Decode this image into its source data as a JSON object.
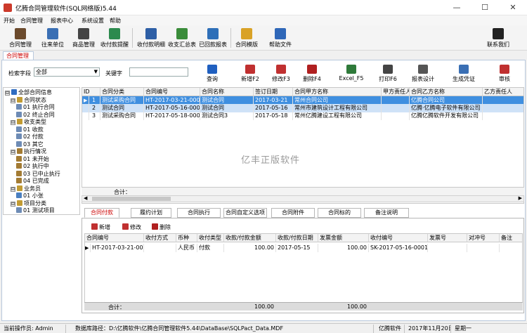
{
  "window": {
    "title": "亿腾合同管理软件(SQL网络版)5.44",
    "minimize": "—",
    "maximize": "☐",
    "close": "✕"
  },
  "menu": [
    "开始",
    "合同管理",
    "报表中心",
    "系统设置",
    "帮助"
  ],
  "toolbar": {
    "items": [
      {
        "label": "合同管理",
        "icon": "contract-icon",
        "color": "#6b4a2c"
      },
      {
        "label": "往来单位",
        "icon": "partner-icon",
        "color": "#3a6fb4"
      },
      {
        "label": "商品管理",
        "icon": "goods-icon",
        "color": "#444444"
      },
      {
        "label": "收付款提醒",
        "icon": "reminder-icon",
        "color": "#2c8a4e"
      },
      {
        "label": "收付款明细",
        "icon": "receipt-detail-icon",
        "color": "#2e5fa6"
      },
      {
        "label": "收支汇总表",
        "icon": "summary-icon",
        "color": "#3a8c3a"
      },
      {
        "label": "已回款报表",
        "icon": "chart-icon",
        "color": "#2e6fb8"
      },
      {
        "label": "合同模版",
        "icon": "template-icon",
        "color": "#d9a227"
      },
      {
        "label": "帮助文件",
        "icon": "help-icon",
        "color": "#2f67b8"
      },
      {
        "label": "联系我们",
        "icon": "qq-icon",
        "color": "#222222"
      }
    ]
  },
  "doc_tab": "合同管理",
  "search": {
    "field_label": "检索字段",
    "field_value": "全部",
    "keyword_label": "关键字",
    "keyword_value": ""
  },
  "search_buttons": [
    {
      "label": "查询",
      "icon": "search-icon",
      "color": "#2060c0"
    },
    {
      "label": "新增F2",
      "icon": "add-icon",
      "color": "#c03030"
    },
    {
      "label": "修改F3",
      "icon": "edit-icon",
      "color": "#c03030"
    },
    {
      "label": "删除F4",
      "icon": "delete-icon",
      "color": "#b02020"
    },
    {
      "label": "Excel_F5",
      "icon": "excel-icon",
      "color": "#2f7a3a"
    },
    {
      "label": "打印F6",
      "icon": "print-icon",
      "color": "#444444"
    },
    {
      "label": "报表设计",
      "icon": "design-icon",
      "color": "#555555"
    },
    {
      "label": "生成凭证",
      "icon": "voucher-icon",
      "color": "#3a6fb4"
    },
    {
      "label": "审核",
      "icon": "audit-icon",
      "color": "#c03030"
    }
  ],
  "tree": [
    {
      "label": "全部合同信息",
      "level": 0,
      "expander": "⊟",
      "icon": "globe-icon",
      "color": "#2f6cc1"
    },
    {
      "label": "合同状态",
      "level": 1,
      "expander": "⊟",
      "icon": "folder-icon",
      "color": "#c29b33"
    },
    {
      "label": "01 执行合同",
      "level": 2,
      "expander": "",
      "icon": "doc-icon",
      "color": "#6d8bb5"
    },
    {
      "label": "02 终止合同",
      "level": 2,
      "expander": "",
      "icon": "doc-icon",
      "color": "#6d8bb5"
    },
    {
      "label": "收支类型",
      "level": 1,
      "expander": "⊟",
      "icon": "folder-icon",
      "color": "#c29b33"
    },
    {
      "label": "01 收款",
      "level": 2,
      "expander": "",
      "icon": "doc-icon",
      "color": "#6d8bb5"
    },
    {
      "label": "02 付款",
      "level": 2,
      "expander": "",
      "icon": "doc-icon",
      "color": "#6d8bb5"
    },
    {
      "label": "03 其它",
      "level": 2,
      "expander": "",
      "icon": "doc-icon",
      "color": "#6d8bb5"
    },
    {
      "label": "执行情况",
      "level": 1,
      "expander": "⊟",
      "icon": "clock-icon",
      "color": "#a37b33"
    },
    {
      "label": "01 未开始",
      "level": 2,
      "expander": "",
      "icon": "clock-icon",
      "color": "#a37b33"
    },
    {
      "label": "02 执行中",
      "level": 2,
      "expander": "",
      "icon": "clock-icon",
      "color": "#a37b33"
    },
    {
      "label": "03 已中止执行",
      "level": 2,
      "expander": "",
      "icon": "clock-icon",
      "color": "#a37b33"
    },
    {
      "label": "04 已完成",
      "level": 2,
      "expander": "",
      "icon": "clock-icon",
      "color": "#a37b33"
    },
    {
      "label": "业务员",
      "level": 1,
      "expander": "⊟",
      "icon": "folder-icon",
      "color": "#c29b33"
    },
    {
      "label": "01 小张",
      "level": 2,
      "expander": "",
      "icon": "person-icon",
      "color": "#4a7fc0"
    },
    {
      "label": "项目分类",
      "level": 1,
      "expander": "⊟",
      "icon": "folder-icon",
      "color": "#c29b33"
    },
    {
      "label": "01 测试项目",
      "level": 2,
      "expander": "",
      "icon": "doc-icon",
      "color": "#6d8bb5"
    }
  ],
  "upper_grid": {
    "columns": [
      "ID",
      "合同分类",
      "合同编号",
      "合同名称",
      "签订日期",
      "合同甲方名称",
      "甲方责任人",
      "合同乙方名称",
      "乙方责任人"
    ],
    "rows": [
      {
        "marker": "▶",
        "cells": [
          "1",
          "测试采购合同",
          "HT-2017-03-21-0001",
          "测试合同",
          "2017-03-21",
          "常州合同公司",
          "",
          "亿腾合同公司",
          ""
        ]
      },
      {
        "marker": "",
        "cells": [
          "2",
          "测试合同",
          "HT-2017-05-16-0001",
          "测试合同",
          "2017-05-16",
          "常州市建筑设计工程有限公司",
          "",
          "亿腾·亿腾电子软件有限公司",
          ""
        ]
      },
      {
        "marker": "",
        "cells": [
          "3",
          "测试采购合同",
          "HT-2017-05-18-0001",
          "测试合同3",
          "2017-05-18",
          "常州亿腾建设工程有限公司",
          "",
          "亿腾亿腾软件开发有限公司",
          ""
        ]
      }
    ],
    "footer_label": "合计：",
    "watermark": "亿丰正版软件"
  },
  "lower_tabs": [
    "合同付款",
    "履约计划",
    "合同执行",
    "合同自定义选项",
    "合同附件",
    "合同标的",
    "备注说明"
  ],
  "lower_buttons": [
    {
      "label": "新增",
      "icon": "add-icon",
      "color": "#c03030"
    },
    {
      "label": "修改",
      "icon": "edit-icon",
      "color": "#c03030"
    },
    {
      "label": "删除",
      "icon": "delete-icon",
      "color": "#b02020"
    }
  ],
  "lower_grid": {
    "columns": [
      "合同编号",
      "收付方式",
      "币种",
      "收付类型",
      "收款/付款金额",
      "收款/付款日期",
      "发票金额",
      "收付编号",
      "发票号",
      "对冲号",
      "备注"
    ],
    "rows": [
      {
        "marker": "▶",
        "cells": [
          "HT-2017-03-21-0001",
          "",
          "人民币",
          "付款",
          "100.00",
          "2017-05-15",
          "100.00",
          "SK-2017-05-16-0001",
          "",
          "",
          ""
        ]
      }
    ],
    "footer_label": "合计：",
    "footer_amount": "100.00",
    "footer_invoice": "100.00"
  },
  "status": {
    "user": "当前操作员: Admin",
    "db_path": "数据库路径：D:\\亿腾软件\\亿腾合同管理软件5.44\\DataBase\\SQLPact_Data.MDF",
    "vendor": "亿腾软件",
    "date": "2017年11月20日",
    "weekday": "星期一"
  },
  "colors": {
    "row_selected": "#3f8fe0",
    "row_selected_text": "#ffffff",
    "row_alt": "#cfe2f7",
    "doc_tab_text": "#cc0000"
  }
}
